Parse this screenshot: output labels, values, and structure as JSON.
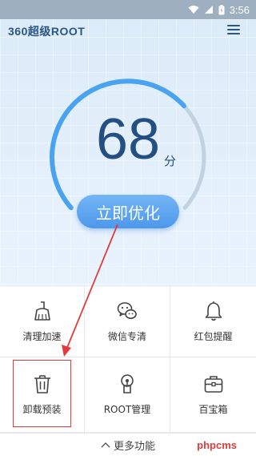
{
  "status_bar": {
    "time": "3:56"
  },
  "header": {
    "app_title": "360超级ROOT"
  },
  "score": {
    "value": "68",
    "unit": "分",
    "level": 0.68
  },
  "optimize_button": {
    "label": "立即优化"
  },
  "tools": [
    {
      "label": "清理加速",
      "icon": "broom-icon"
    },
    {
      "label": "微信专清",
      "icon": "wechat-icon"
    },
    {
      "label": "红包提醒",
      "icon": "bell-icon"
    },
    {
      "label": "卸载预装",
      "icon": "trash-icon"
    },
    {
      "label": "ROOT管理",
      "icon": "keyhole-icon"
    },
    {
      "label": "百宝箱",
      "icon": "toolbox-icon"
    }
  ],
  "more": {
    "label": "更多功能"
  },
  "watermark": {
    "text": "phpcms"
  },
  "colors": {
    "accent": "#4d98ec",
    "title": "#2a5584",
    "annotation": "#e23b3b"
  }
}
